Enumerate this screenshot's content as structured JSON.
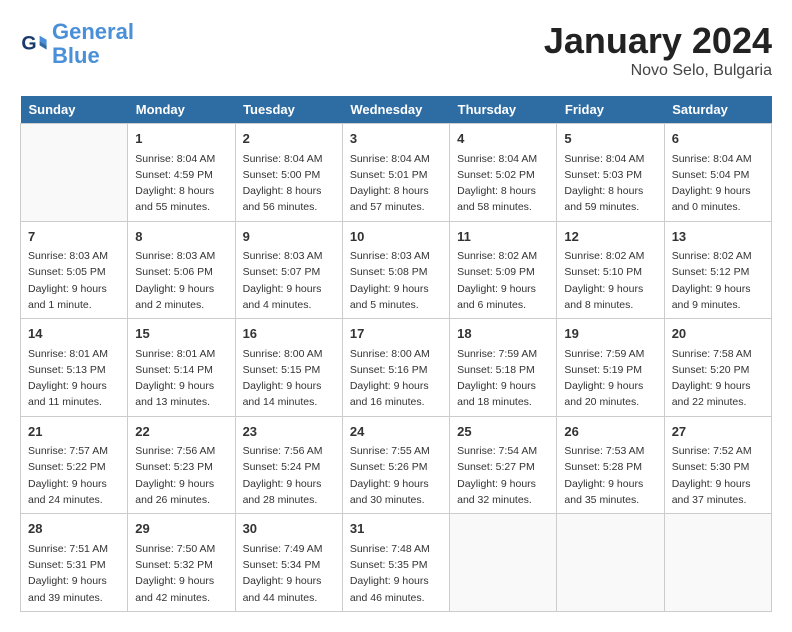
{
  "logo": {
    "line1": "General",
    "line2": "Blue"
  },
  "title": "January 2024",
  "subtitle": "Novo Selo, Bulgaria",
  "days_of_week": [
    "Sunday",
    "Monday",
    "Tuesday",
    "Wednesday",
    "Thursday",
    "Friday",
    "Saturday"
  ],
  "weeks": [
    [
      {
        "day": "",
        "info": ""
      },
      {
        "day": "1",
        "info": "Sunrise: 8:04 AM\nSunset: 4:59 PM\nDaylight: 8 hours\nand 55 minutes."
      },
      {
        "day": "2",
        "info": "Sunrise: 8:04 AM\nSunset: 5:00 PM\nDaylight: 8 hours\nand 56 minutes."
      },
      {
        "day": "3",
        "info": "Sunrise: 8:04 AM\nSunset: 5:01 PM\nDaylight: 8 hours\nand 57 minutes."
      },
      {
        "day": "4",
        "info": "Sunrise: 8:04 AM\nSunset: 5:02 PM\nDaylight: 8 hours\nand 58 minutes."
      },
      {
        "day": "5",
        "info": "Sunrise: 8:04 AM\nSunset: 5:03 PM\nDaylight: 8 hours\nand 59 minutes."
      },
      {
        "day": "6",
        "info": "Sunrise: 8:04 AM\nSunset: 5:04 PM\nDaylight: 9 hours\nand 0 minutes."
      }
    ],
    [
      {
        "day": "7",
        "info": "Sunrise: 8:03 AM\nSunset: 5:05 PM\nDaylight: 9 hours\nand 1 minute."
      },
      {
        "day": "8",
        "info": "Sunrise: 8:03 AM\nSunset: 5:06 PM\nDaylight: 9 hours\nand 2 minutes."
      },
      {
        "day": "9",
        "info": "Sunrise: 8:03 AM\nSunset: 5:07 PM\nDaylight: 9 hours\nand 4 minutes."
      },
      {
        "day": "10",
        "info": "Sunrise: 8:03 AM\nSunset: 5:08 PM\nDaylight: 9 hours\nand 5 minutes."
      },
      {
        "day": "11",
        "info": "Sunrise: 8:02 AM\nSunset: 5:09 PM\nDaylight: 9 hours\nand 6 minutes."
      },
      {
        "day": "12",
        "info": "Sunrise: 8:02 AM\nSunset: 5:10 PM\nDaylight: 9 hours\nand 8 minutes."
      },
      {
        "day": "13",
        "info": "Sunrise: 8:02 AM\nSunset: 5:12 PM\nDaylight: 9 hours\nand 9 minutes."
      }
    ],
    [
      {
        "day": "14",
        "info": "Sunrise: 8:01 AM\nSunset: 5:13 PM\nDaylight: 9 hours\nand 11 minutes."
      },
      {
        "day": "15",
        "info": "Sunrise: 8:01 AM\nSunset: 5:14 PM\nDaylight: 9 hours\nand 13 minutes."
      },
      {
        "day": "16",
        "info": "Sunrise: 8:00 AM\nSunset: 5:15 PM\nDaylight: 9 hours\nand 14 minutes."
      },
      {
        "day": "17",
        "info": "Sunrise: 8:00 AM\nSunset: 5:16 PM\nDaylight: 9 hours\nand 16 minutes."
      },
      {
        "day": "18",
        "info": "Sunrise: 7:59 AM\nSunset: 5:18 PM\nDaylight: 9 hours\nand 18 minutes."
      },
      {
        "day": "19",
        "info": "Sunrise: 7:59 AM\nSunset: 5:19 PM\nDaylight: 9 hours\nand 20 minutes."
      },
      {
        "day": "20",
        "info": "Sunrise: 7:58 AM\nSunset: 5:20 PM\nDaylight: 9 hours\nand 22 minutes."
      }
    ],
    [
      {
        "day": "21",
        "info": "Sunrise: 7:57 AM\nSunset: 5:22 PM\nDaylight: 9 hours\nand 24 minutes."
      },
      {
        "day": "22",
        "info": "Sunrise: 7:56 AM\nSunset: 5:23 PM\nDaylight: 9 hours\nand 26 minutes."
      },
      {
        "day": "23",
        "info": "Sunrise: 7:56 AM\nSunset: 5:24 PM\nDaylight: 9 hours\nand 28 minutes."
      },
      {
        "day": "24",
        "info": "Sunrise: 7:55 AM\nSunset: 5:26 PM\nDaylight: 9 hours\nand 30 minutes."
      },
      {
        "day": "25",
        "info": "Sunrise: 7:54 AM\nSunset: 5:27 PM\nDaylight: 9 hours\nand 32 minutes."
      },
      {
        "day": "26",
        "info": "Sunrise: 7:53 AM\nSunset: 5:28 PM\nDaylight: 9 hours\nand 35 minutes."
      },
      {
        "day": "27",
        "info": "Sunrise: 7:52 AM\nSunset: 5:30 PM\nDaylight: 9 hours\nand 37 minutes."
      }
    ],
    [
      {
        "day": "28",
        "info": "Sunrise: 7:51 AM\nSunset: 5:31 PM\nDaylight: 9 hours\nand 39 minutes."
      },
      {
        "day": "29",
        "info": "Sunrise: 7:50 AM\nSunset: 5:32 PM\nDaylight: 9 hours\nand 42 minutes."
      },
      {
        "day": "30",
        "info": "Sunrise: 7:49 AM\nSunset: 5:34 PM\nDaylight: 9 hours\nand 44 minutes."
      },
      {
        "day": "31",
        "info": "Sunrise: 7:48 AM\nSunset: 5:35 PM\nDaylight: 9 hours\nand 46 minutes."
      },
      {
        "day": "",
        "info": ""
      },
      {
        "day": "",
        "info": ""
      },
      {
        "day": "",
        "info": ""
      }
    ]
  ]
}
